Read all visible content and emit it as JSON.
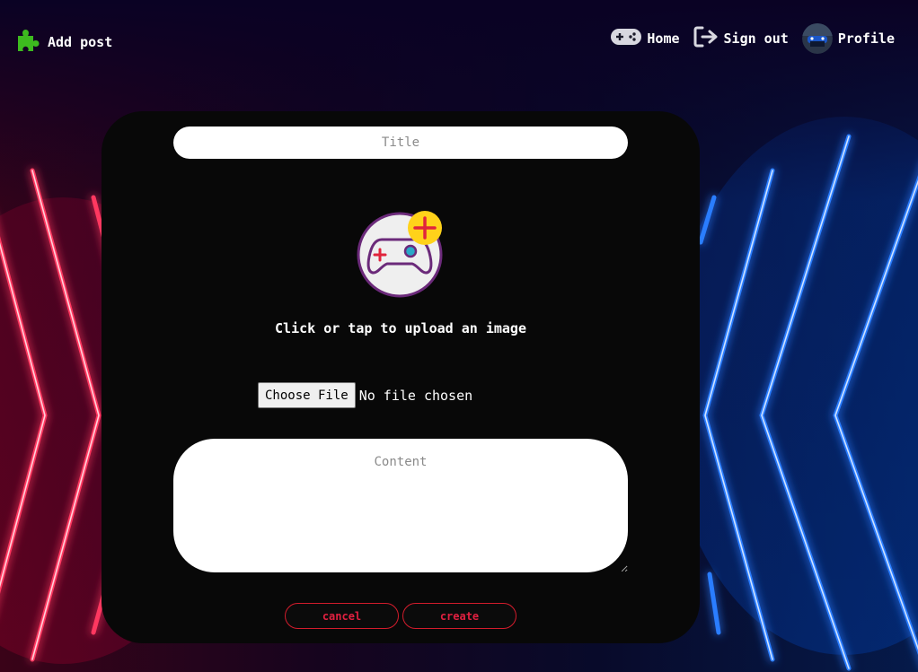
{
  "nav": {
    "add_post_label": "Add post",
    "home_label": "Home",
    "sign_out_label": "Sign out",
    "profile_label": "Profile"
  },
  "icons": {
    "add_post": "puzzle-icon",
    "home": "gamepad-icon",
    "sign_out": "sign-out-icon",
    "upload": "gamepad-plus-icon"
  },
  "form": {
    "title_placeholder": "Title",
    "upload_text": "Click or tap to upload an image",
    "choose_file_label": "Choose File",
    "file_status": "No file chosen",
    "content_placeholder": "Content",
    "cancel_label": "cancel",
    "create_label": "create"
  },
  "colors": {
    "card_bg": "#080808",
    "accent_red": "#e02040",
    "puzzle_green": "#3dbb1f",
    "neon_red": "#ff2050",
    "neon_blue": "#1a6cff"
  }
}
